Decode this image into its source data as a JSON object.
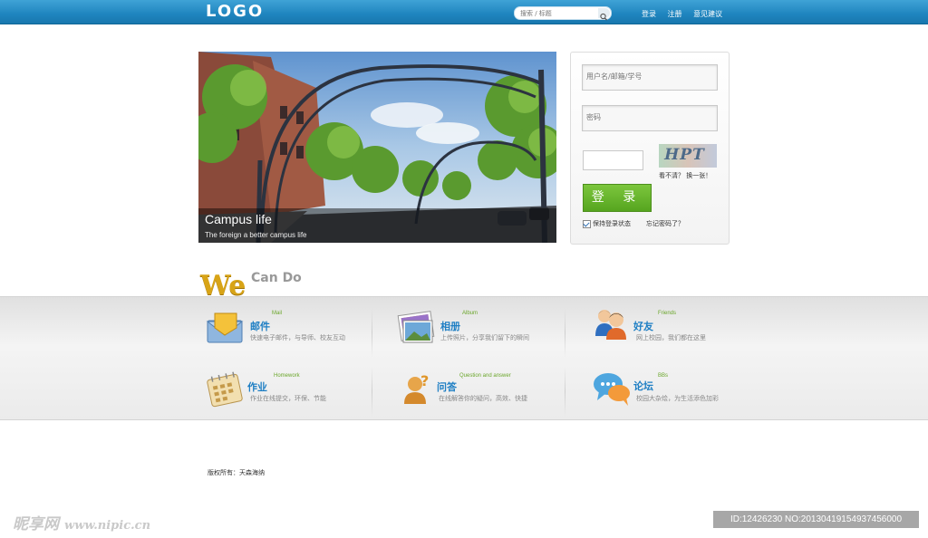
{
  "header": {
    "logo": "LOGO",
    "search_placeholder": "搜索 / 标题",
    "links": [
      "登录",
      "注册",
      "意见建议"
    ]
  },
  "banner": {
    "title": "Campus life",
    "subtitle": "The foreign a better campus life"
  },
  "login": {
    "username_placeholder": "用户名/邮箱/学号",
    "password_placeholder": "密码",
    "captcha_text": "HPT",
    "captcha_hint": "看不清？ 换一张！",
    "submit_label": "登 录",
    "remember_label": "保持登录状态",
    "forgot_label": "忘记密码了？"
  },
  "section": {
    "we": "We",
    "can_do": "Can Do"
  },
  "features": [
    {
      "en": "Mail",
      "zh": "邮件",
      "desc": "快速电子邮件，与导师、校友互动"
    },
    {
      "en": "Album",
      "zh": "相册",
      "desc": "上传照片，分享我们留下的瞬间"
    },
    {
      "en": "Friends",
      "zh": "好友",
      "desc": "网上校园，我们都在这里"
    },
    {
      "en": "Homework",
      "zh": "作业",
      "desc": "作业在线提交，环保、节能"
    },
    {
      "en": "Question and answer",
      "zh": "问答",
      "desc": "在线解答你的疑问，高效、快捷"
    },
    {
      "en": "BBs",
      "zh": "论坛",
      "desc": "校园大杂烩，为生活添色加彩"
    }
  ],
  "footer": {
    "copyright": "版权所有：天森海纳"
  },
  "watermarks": {
    "left_cn": "昵享网",
    "left_url": "www.nipic.cn",
    "right": "ID:12426230 NO:20130419154937456000"
  }
}
